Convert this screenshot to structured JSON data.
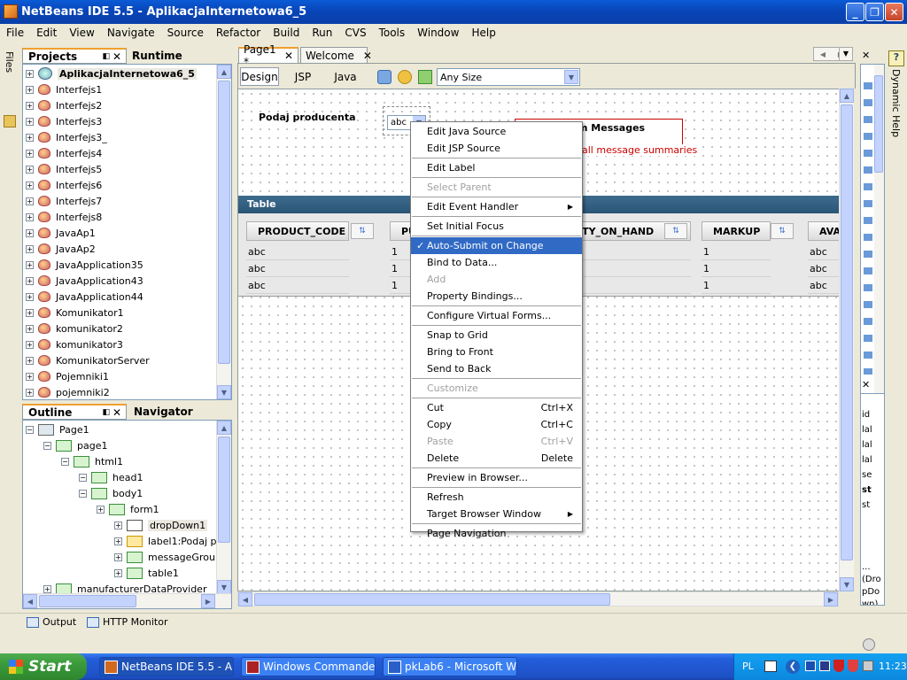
{
  "window": {
    "title": "NetBeans IDE 5.5 - AplikacjaInternetowa6_5",
    "min": "_",
    "max": "❐",
    "close": "✕"
  },
  "menu": [
    "File",
    "Edit",
    "View",
    "Navigate",
    "Source",
    "Refactor",
    "Build",
    "Run",
    "CVS",
    "Tools",
    "Window",
    "Help"
  ],
  "left_strip": {
    "files_label": "Files"
  },
  "projects_panel": {
    "tab_projects": "Projects",
    "tab_runtime": "Runtime",
    "items": [
      "AplikacjaInternetowa6_5",
      "Interfejs1",
      "Interfejs2",
      "Interfejs3",
      "Interfejs3_",
      "Interfejs4",
      "Interfejs5",
      "Interfejs6",
      "Interfejs7",
      "Interfejs8",
      "JavaAp1",
      "JavaAp2",
      "JavaApplication35",
      "JavaApplication43",
      "JavaApplication44",
      "Komunikator1",
      "komunikator2",
      "komunikator3",
      "KomunikatorServer",
      "Pojemniki1",
      "pojemniki2"
    ]
  },
  "outline_panel": {
    "tab_outline": "Outline",
    "tab_navigator": "Navigator",
    "nodes": [
      {
        "label": "Page1",
        "depth": 0
      },
      {
        "label": "page1",
        "depth": 1
      },
      {
        "label": "html1",
        "depth": 2
      },
      {
        "label": "head1",
        "depth": 3
      },
      {
        "label": "body1",
        "depth": 3
      },
      {
        "label": "form1",
        "depth": 4
      },
      {
        "label": "dropDown1",
        "depth": 5
      },
      {
        "label": "label1:Podaj pro",
        "depth": 5
      },
      {
        "label": "messageGroup1",
        "depth": 5
      },
      {
        "label": "table1",
        "depth": 5
      },
      {
        "label": "manufacturerDataProvider",
        "depth": 1
      }
    ]
  },
  "editor": {
    "tabs": [
      {
        "label": "Page1 *"
      },
      {
        "label": "Welcome"
      }
    ],
    "view_tabs": [
      "Design",
      "JSP",
      "Java"
    ],
    "size_select": "Any Size"
  },
  "canvas": {
    "label_text": "Podaj producenta",
    "dropdown_value": "abc",
    "messages_title": "m Messages",
    "messages_text": "all message summaries",
    "table_title": "Table",
    "columns": [
      "PRODUCT_CODE",
      "PU",
      "ITY_ON_HAND",
      "MARKUP",
      "AVA"
    ],
    "sort_glyph": "⇅",
    "rows": [
      [
        "abc",
        "1",
        "",
        "1",
        "abc"
      ],
      [
        "abc",
        "1",
        "",
        "1",
        "abc"
      ],
      [
        "abc",
        "1",
        "",
        "1",
        "abc"
      ]
    ]
  },
  "context_menu": [
    {
      "label": "Edit Java Source"
    },
    {
      "label": "Edit JSP Source"
    },
    {
      "sep": true
    },
    {
      "label": "Edit Label"
    },
    {
      "sep": true
    },
    {
      "label": "Select Parent",
      "disabled": true
    },
    {
      "sep": true
    },
    {
      "label": "Edit Event Handler",
      "submenu": true
    },
    {
      "sep": true
    },
    {
      "label": "Set Initial Focus"
    },
    {
      "sep": true
    },
    {
      "label": "Auto-Submit on Change",
      "checked": true,
      "selected": true
    },
    {
      "label": "Bind to Data..."
    },
    {
      "label": "Add",
      "disabled": true
    },
    {
      "label": "Property Bindings..."
    },
    {
      "sep": true
    },
    {
      "label": "Configure Virtual Forms..."
    },
    {
      "sep": true
    },
    {
      "label": "Snap to Grid"
    },
    {
      "label": "Bring to Front"
    },
    {
      "label": "Send to Back"
    },
    {
      "sep": true
    },
    {
      "label": "Customize",
      "disabled": true
    },
    {
      "sep": true
    },
    {
      "label": "Cut",
      "shortcut": "Ctrl+X"
    },
    {
      "label": "Copy",
      "shortcut": "Ctrl+C"
    },
    {
      "label": "Paste",
      "shortcut": "Ctrl+V",
      "disabled": true
    },
    {
      "label": "Delete",
      "shortcut": "Delete"
    },
    {
      "sep": true
    },
    {
      "label": "Preview in Browser..."
    },
    {
      "sep": true
    },
    {
      "label": "Refresh"
    },
    {
      "label": "Target Browser Window",
      "submenu": true
    },
    {
      "sep": true
    },
    {
      "label": "Page Navigation"
    }
  ],
  "right_panel": {
    "dynamic_help": "Dynamic Help",
    "props": [
      "id",
      "lal",
      "lal",
      "lal",
      "se",
      "st",
      "st"
    ],
    "props_bottom": [
      "...",
      "(Dro",
      "pDo",
      "wn)"
    ]
  },
  "bottom_bar": {
    "output": "Output",
    "http_monitor": "HTTP Monitor"
  },
  "taskbar": {
    "start": "Start",
    "tasks": [
      {
        "label": "NetBeans IDE 5.5 - A...",
        "active": true
      },
      {
        "label": "Windows Commander..."
      },
      {
        "label": "pkLab6 - Microsoft W..."
      }
    ],
    "lang": "PL",
    "clock": "11:23"
  }
}
